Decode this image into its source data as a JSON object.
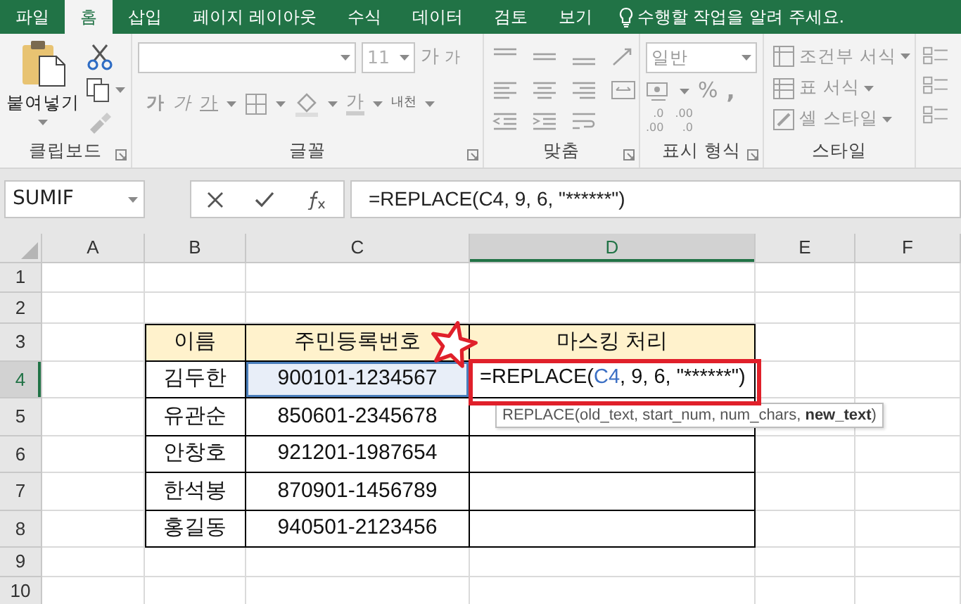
{
  "tabs": [
    {
      "label": "파일",
      "selected": false
    },
    {
      "label": "홈",
      "selected": true
    },
    {
      "label": "삽입",
      "selected": false
    },
    {
      "label": "페이지 레이아웃",
      "selected": false
    },
    {
      "label": "수식",
      "selected": false
    },
    {
      "label": "데이터",
      "selected": false
    },
    {
      "label": "검토",
      "selected": false
    },
    {
      "label": "보기",
      "selected": false
    }
  ],
  "tell_me": "수행할 작업을 알려 주세요.",
  "ribbon": {
    "disabled": true,
    "clipboard": {
      "paste": "붙여넣기",
      "label": "클립보드"
    },
    "font": {
      "size": "11",
      "grow": "가",
      "shrink": "가",
      "bold": "가",
      "italic": "가",
      "underline": "가",
      "font_color": "가",
      "phonetic": "내천",
      "label": "글꼴"
    },
    "alignment": {
      "label": "맞춤"
    },
    "number": {
      "format": "일반",
      "percent": "%",
      "comma": ",",
      "decimal_buttons": [
        {
          "top": ".0",
          "bottom": ".00"
        },
        {
          "top": ".00",
          "bottom": ".0"
        }
      ],
      "label": "표시 형식"
    },
    "styles": {
      "items": [
        "조건부 서식",
        "표 서식",
        "셀 스타일"
      ],
      "label": "스타일"
    }
  },
  "formula_bar": {
    "name_box": "SUMIF",
    "formula": "=REPLACE(C4, 9, 6, \"******\")"
  },
  "sheet": {
    "columns": [
      {
        "label": "A",
        "selected": false
      },
      {
        "label": "B",
        "selected": false
      },
      {
        "label": "C",
        "selected": false
      },
      {
        "label": "D",
        "selected": true
      },
      {
        "label": "E",
        "selected": false
      },
      {
        "label": "F",
        "selected": false
      }
    ],
    "rows": [
      {
        "label": "1",
        "selected": false
      },
      {
        "label": "2",
        "selected": false
      },
      {
        "label": "3",
        "selected": false
      },
      {
        "label": "4",
        "selected": true
      },
      {
        "label": "5",
        "selected": false
      },
      {
        "label": "6",
        "selected": false
      },
      {
        "label": "7",
        "selected": false
      },
      {
        "label": "8",
        "selected": false
      },
      {
        "label": "9",
        "selected": false
      },
      {
        "label": "10",
        "selected": false
      }
    ],
    "table": {
      "header": [
        "이름",
        "주민등록번호",
        "마스킹 처리"
      ],
      "rows": [
        [
          {
            "text": "김두한"
          },
          {
            "text": "900101-1234567",
            "referenced": true
          },
          {
            "kind": "editing",
            "parts": [
              {
                "text": "=REPLACE(",
                "kind": "plain"
              },
              {
                "text": "C4",
                "kind": "reference"
              },
              {
                "text": ", 9, 6, \"******\")",
                "kind": "plain"
              }
            ]
          }
        ],
        [
          {
            "text": "유관순"
          },
          {
            "text": "850601-2345678",
            "referenced": false
          }
        ],
        [
          {
            "text": "안창호"
          },
          {
            "text": "921201-1987654",
            "referenced": false
          }
        ],
        [
          {
            "text": "한석봉"
          },
          {
            "text": "870901-1456789",
            "referenced": false
          }
        ],
        [
          {
            "text": "홍길동"
          },
          {
            "text": "940501-2123456",
            "referenced": false
          }
        ]
      ]
    }
  },
  "tooltip": "REPLACE(old_text, start_num, num_chars, **new_text**)"
}
